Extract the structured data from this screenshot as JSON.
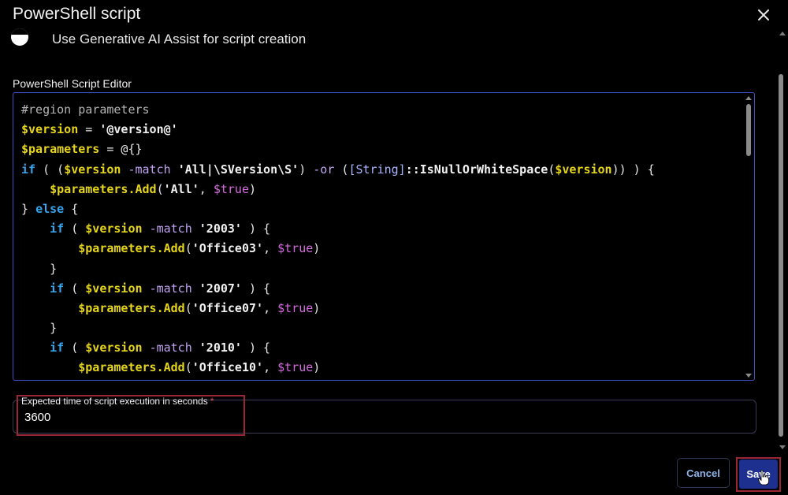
{
  "dialog": {
    "title": "PowerShell script",
    "close_icon": "close-icon"
  },
  "genai": {
    "label": "Use Generative AI Assist for script creation",
    "toggle_state": "on"
  },
  "editor": {
    "label": "PowerShell Script Editor",
    "lines": [
      "#region parameters",
      "$version = '@version@'",
      "$parameters = @{}",
      "if ( ($version -match 'All|\\SVersion\\S') -or ([String]::IsNullOrWhiteSpace($version)) ) {",
      "    $parameters.Add('All', $true)",
      "} else {",
      "    if ( $version -match '2003' ) {",
      "        $parameters.Add('Office03', $true)",
      "    }",
      "    if ( $version -match '2007' ) {",
      "        $parameters.Add('Office07', $true)",
      "    }",
      "    if ( $version -match '2010' ) {",
      "        $parameters.Add('Office10', $true)"
    ]
  },
  "execution_time": {
    "label": "Expected time of script execution in seconds",
    "required_mark": "*",
    "value": "3600"
  },
  "footer": {
    "cancel_label": "Cancel",
    "save_label": "Save"
  },
  "colors": {
    "background": "#000000",
    "accent_border": "#3f4fc4",
    "save_button": "#1d2f8f",
    "highlight": "#9b2735",
    "variable": "#e5d51a",
    "keyword": "#36a4ea",
    "boolean": "#d66be0"
  }
}
